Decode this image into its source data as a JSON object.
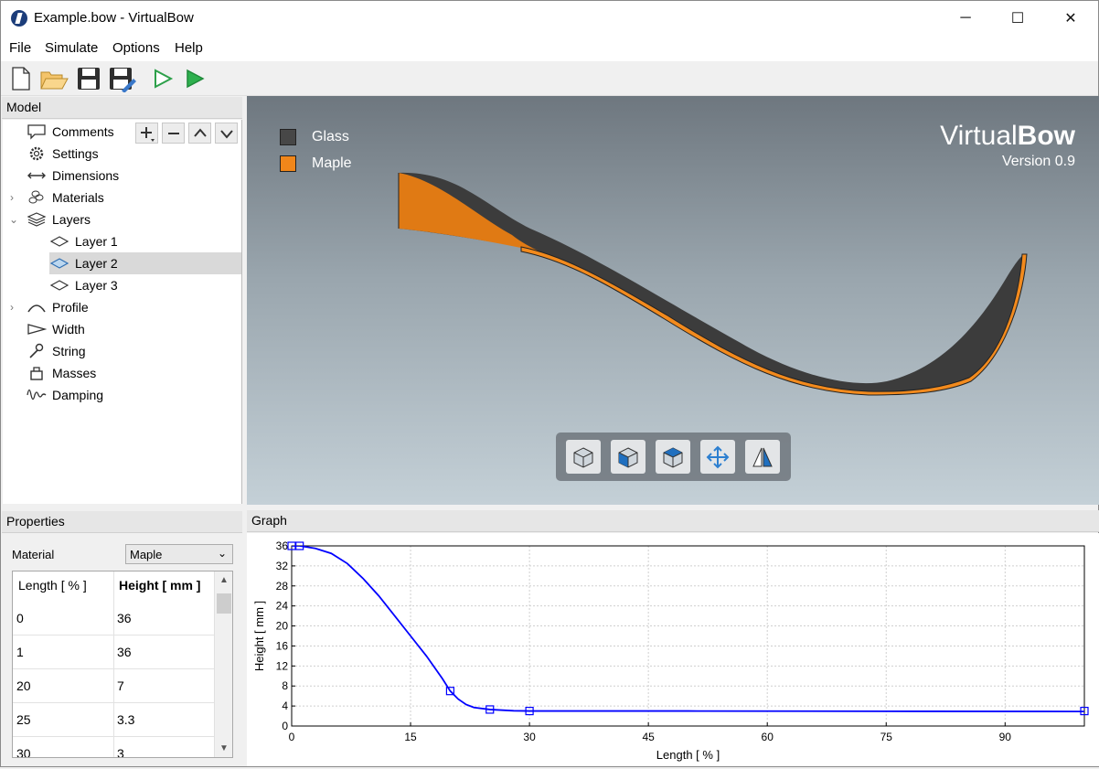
{
  "window": {
    "title": "Example.bow - VirtualBow",
    "minimize": "─",
    "maximize": "☐",
    "close": "✕"
  },
  "menu": [
    "File",
    "Simulate",
    "Options",
    "Help"
  ],
  "toolbar": [
    "new-file-icon",
    "open-folder-icon",
    "save-icon",
    "save-as-icon",
    "run-static-icon",
    "run-dynamic-icon"
  ],
  "model": {
    "title": "Model",
    "items": [
      {
        "label": "Comments",
        "icon": "comments-icon"
      },
      {
        "label": "Settings",
        "icon": "gear-icon"
      },
      {
        "label": "Dimensions",
        "icon": "dimensions-icon"
      },
      {
        "label": "Materials",
        "icon": "materials-icon"
      },
      {
        "label": "Layers",
        "icon": "layers-icon"
      },
      {
        "label": "Layer 1",
        "icon": "layer-icon"
      },
      {
        "label": "Layer 2",
        "icon": "layer-icon",
        "selected": true
      },
      {
        "label": "Layer 3",
        "icon": "layer-icon"
      },
      {
        "label": "Profile",
        "icon": "profile-icon"
      },
      {
        "label": "Width",
        "icon": "width-icon"
      },
      {
        "label": "String",
        "icon": "string-icon"
      },
      {
        "label": "Masses",
        "icon": "masses-icon"
      },
      {
        "label": "Damping",
        "icon": "damping-icon"
      }
    ]
  },
  "view": {
    "legend": [
      {
        "label": "Glass",
        "color": "#474747"
      },
      {
        "label": "Maple",
        "color": "#f0861a"
      }
    ],
    "brand_prefix": "Virtual",
    "brand_suffix": "Bow",
    "version": "Version 0.9",
    "buttons": [
      "view-3d-icon",
      "view-front-icon",
      "view-side-icon",
      "fit-view-icon",
      "mirror-icon"
    ]
  },
  "properties": {
    "title": "Properties",
    "material_label": "Material",
    "material_value": "Maple",
    "columns": [
      "Length [ % ]",
      "Height [ mm ]"
    ],
    "rows": [
      [
        "0",
        "36"
      ],
      [
        "1",
        "36"
      ],
      [
        "20",
        "7"
      ],
      [
        "25",
        "3.3"
      ],
      [
        "30",
        "3"
      ]
    ]
  },
  "graph": {
    "title": "Graph"
  },
  "chart_data": {
    "type": "line",
    "xlabel": "Length [ % ]",
    "ylabel": "Height [ mm ]",
    "xlim": [
      0,
      100
    ],
    "ylim": [
      0,
      36
    ],
    "xticks": [
      0,
      15,
      30,
      45,
      60,
      75,
      90
    ],
    "yticks": [
      0,
      4,
      8,
      12,
      16,
      20,
      24,
      28,
      32,
      36
    ],
    "grid": true,
    "control_points": [
      [
        0,
        36
      ],
      [
        1,
        36
      ],
      [
        20,
        7
      ],
      [
        25,
        3.3
      ],
      [
        30,
        3
      ],
      [
        100,
        3
      ]
    ],
    "curve": [
      [
        0,
        36
      ],
      [
        1,
        36
      ],
      [
        3,
        35.5
      ],
      [
        5,
        34.5
      ],
      [
        7,
        32.5
      ],
      [
        9,
        29.5
      ],
      [
        11,
        26
      ],
      [
        13,
        22
      ],
      [
        15,
        18
      ],
      [
        17,
        14
      ],
      [
        19,
        9.5
      ],
      [
        20,
        7
      ],
      [
        21,
        5.4
      ],
      [
        22,
        4.3
      ],
      [
        23,
        3.7
      ],
      [
        25,
        3.3
      ],
      [
        28,
        3.05
      ],
      [
        30,
        3
      ],
      [
        50,
        3
      ],
      [
        75,
        2.95
      ],
      [
        100,
        2.9
      ]
    ],
    "line_color": "#0000ff"
  }
}
